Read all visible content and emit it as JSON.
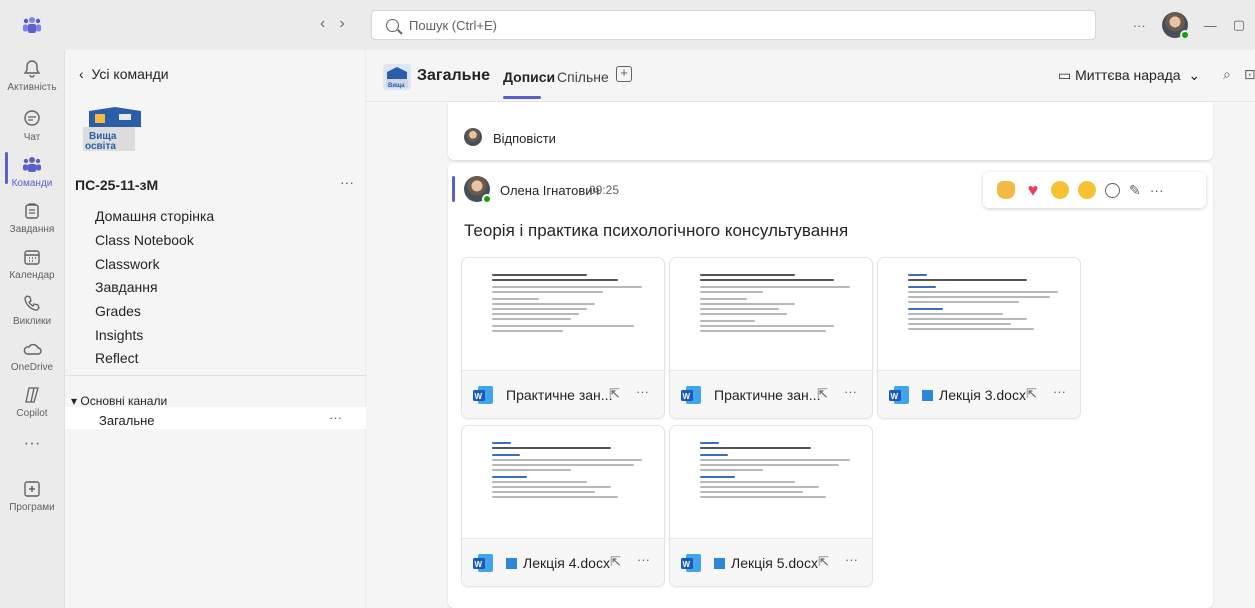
{
  "titlebar": {
    "search_placeholder": "Пошук (Ctrl+E)",
    "more": "···",
    "minimize": "—",
    "restore": "▢"
  },
  "rail": {
    "items": [
      {
        "label": "Активність",
        "icon": "bell-icon"
      },
      {
        "label": "Чат",
        "icon": "chat-icon"
      },
      {
        "label": "Команди",
        "icon": "teams-icon"
      },
      {
        "label": "Завдання",
        "icon": "assignments-icon"
      },
      {
        "label": "Календар",
        "icon": "calendar-icon"
      },
      {
        "label": "Виклики",
        "icon": "phone-icon"
      },
      {
        "label": "OneDrive",
        "icon": "cloud-icon"
      },
      {
        "label": "Copilot",
        "icon": "copilot-icon"
      },
      {
        "label": "",
        "icon": "more-apps-icon"
      },
      {
        "label": "Програми",
        "icon": "apps-add-icon"
      }
    ]
  },
  "panel": {
    "back_label": "Усі команди",
    "team_name": "ПС-25-11-зМ",
    "team_more": "···",
    "links": [
      "Домашня сторінка",
      "Class Notebook",
      "Classwork",
      "Завдання",
      "Grades",
      "Insights",
      "Reflect"
    ],
    "channels_header": "Основні канали",
    "channel_active": "Загальне",
    "channel_more": "···",
    "logo_text": "Вища освіта"
  },
  "main": {
    "channel_title": "Загальне",
    "tabs": [
      "Дописи",
      "Спільне"
    ],
    "meet_label": "Миттєва нарада",
    "reply_label": "Відповісти",
    "post": {
      "author": "Олена Ігнатович",
      "time": "09:25",
      "title": "Теорія і практика психологічного консультування"
    },
    "files": [
      {
        "name": "Практичне зан...",
        "blue": false
      },
      {
        "name": "Практичне зан...",
        "blue": false
      },
      {
        "name": "Лекція 3.docx",
        "blue": true
      },
      {
        "name": "Лекція 4.docx",
        "blue": true
      },
      {
        "name": "Лекція 5.docx",
        "blue": true
      }
    ]
  },
  "colors": {
    "accent": "#5b5fc7",
    "word_blue": "#185abd",
    "presence": "#13a10e"
  }
}
